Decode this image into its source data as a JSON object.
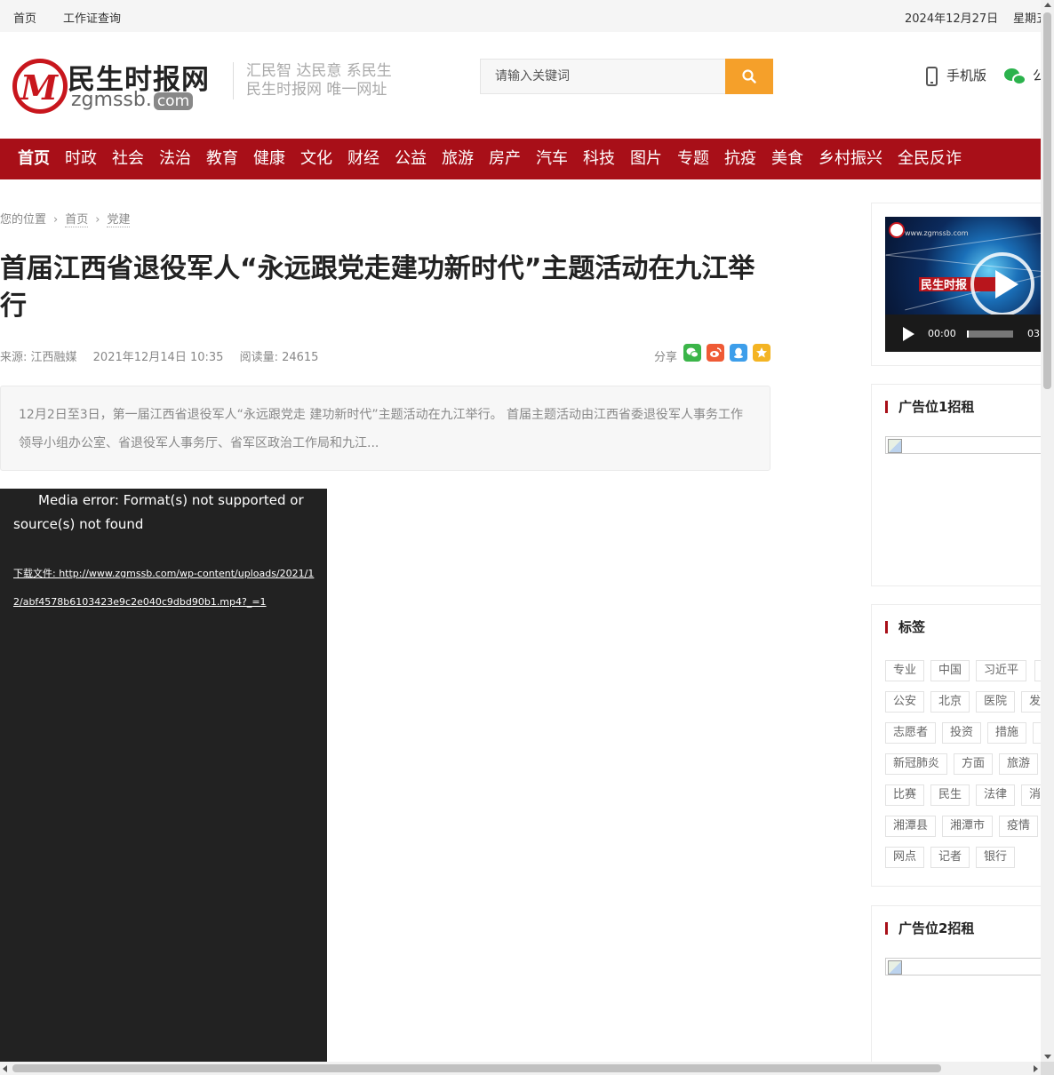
{
  "topbar": {
    "home": "首页",
    "cert_query": "工作证查询",
    "date": "2024年12月27日",
    "weekday": "星期五"
  },
  "header": {
    "logo_cn": "民生时报网",
    "logo_en": "zgmssb.",
    "logo_com": "com",
    "slogan_line1": "汇民智 达民意 系民生",
    "slogan_line2": "民生时报网 唯一网址",
    "search_placeholder": "请输入关键词",
    "mobile_label": "手机版",
    "wechat_label": "公众号"
  },
  "nav": [
    "首页",
    "时政",
    "社会",
    "法治",
    "教育",
    "健康",
    "文化",
    "财经",
    "公益",
    "旅游",
    "房产",
    "汽车",
    "科技",
    "图片",
    "专题",
    "抗疫",
    "美食",
    "乡村振兴",
    "全民反诈"
  ],
  "breadcrumb": {
    "label": "您的位置",
    "home": "首页",
    "category": "党建"
  },
  "article": {
    "title": "首届江西省退役军人“永远跟党走建功新时代”主题活动在九江举行",
    "source": "来源: 江西融媒",
    "datetime": "2021年12月14日 10:35",
    "views": "阅读量: 24615",
    "share_label": "分享",
    "summary": "12月2日至3日，第一届江西省退役军人“永远跟党走 建功新时代”主题活动在九江举行。 首届主题活动由江西省委退役军人事务工作领导小组办公室、省退役军人事务厅、省军区政治工作局和九江...",
    "media_error": "Media error: Format(s) not supported or source(s) not found",
    "download_link": "下载文件: http://www.zgmssb.com/wp-content/uploads/2021/12/abf4578b6103423e9c2e040c9dbd90b1.mp4?_=1"
  },
  "colors": {
    "nav_red": "#a80f18",
    "search_orange": "#f5a02a",
    "wechat_green": "#2bb24c"
  },
  "sidebar": {
    "video": {
      "site_text": "www.zgmssb.com",
      "badge": "民生时报",
      "current_time": "00:00",
      "duration": "03:"
    },
    "ad1_title": "广告位1招租",
    "tags_title": "标签",
    "tags": [
      "专业",
      "中国",
      "习近平",
      "",
      "公安",
      "北京",
      "医院",
      "发展",
      "志愿者",
      "投资",
      "措施",
      "",
      "新冠肺炎",
      "方面",
      "旅游",
      "比赛",
      "民生",
      "法律",
      "消费",
      "湘潭县",
      "湘潭市",
      "疫情",
      "网点",
      "记者",
      "银行"
    ],
    "ad2_title": "广告位2招租"
  }
}
